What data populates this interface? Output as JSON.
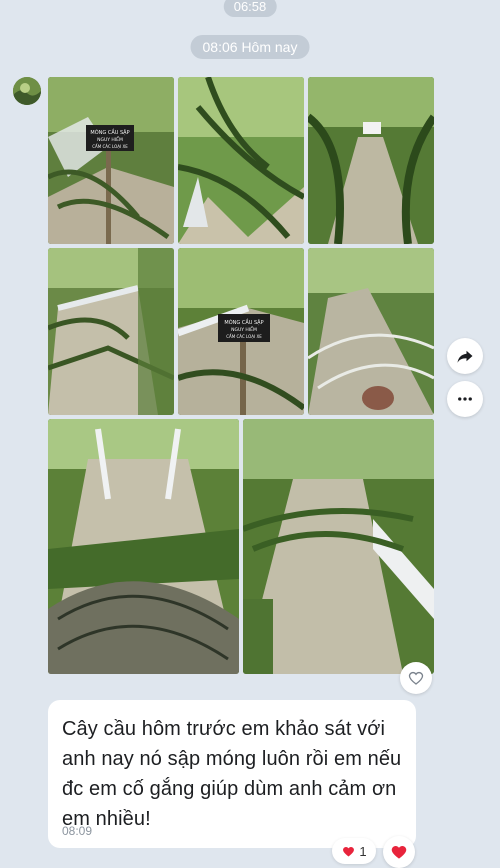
{
  "status": {
    "clock": "06:58"
  },
  "chat": {
    "date_separator": "08:06 Hôm nay",
    "message": {
      "text": "Cây cầu hôm trước em khảo sát với anh nay nó sập móng luôn rồi em nếu đc em cố gắng giúp dùm anh cảm ơn em nhiều!",
      "time": "08:09"
    },
    "reaction": {
      "count": "1",
      "icon": "heart-icon"
    },
    "sign_text": [
      "MÓNG CẦU SẬP",
      "NGUY HIỂM",
      "CẤM CÁC LOẠI XE"
    ],
    "photos": [
      "bridge-sign-photo",
      "palm-frond-photo",
      "jungle-path-photo",
      "broken-deck-photo",
      "bridge-sign-closeup-photo",
      "collapsed-frond-photo",
      "fallen-palm-bridge-photo",
      "bridge-with-frond-photo"
    ]
  },
  "actions": {
    "share_icon": "share-arrow-icon",
    "more_icon": "more-icon",
    "like_icon": "heart-outline-icon"
  },
  "colors": {
    "background": "#dfe6ee",
    "bubble": "#ffffff",
    "pill": "#c3ccd6",
    "heart": "#e8243c"
  }
}
